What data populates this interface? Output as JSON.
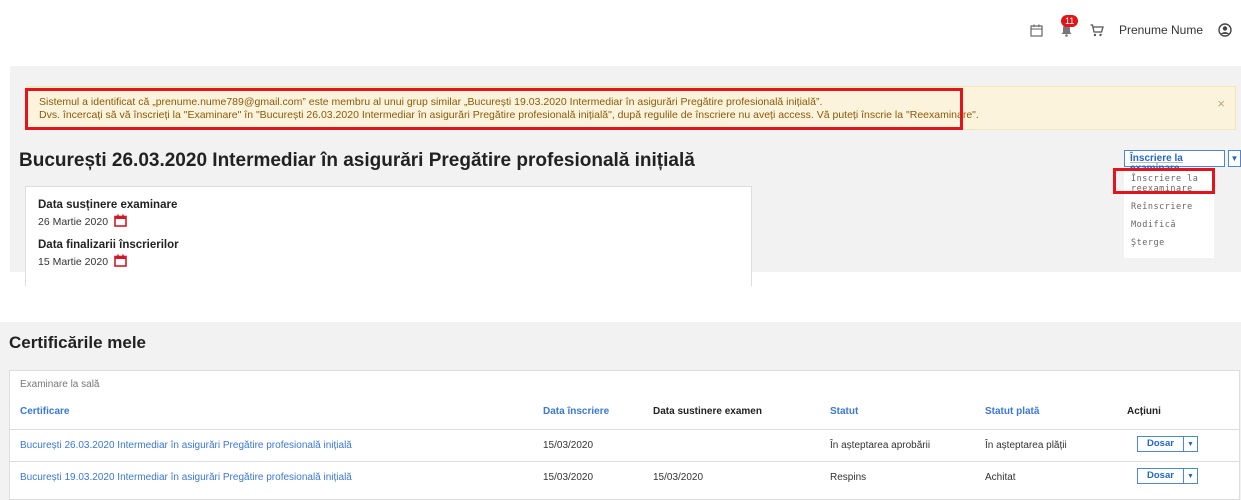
{
  "topbar": {
    "notifications_count": "11",
    "user_name": "Prenume Nume",
    "icons": [
      "calendar-icon",
      "bell-icon",
      "cart-icon",
      "user-circle-icon"
    ]
  },
  "alert": {
    "line1": "Sistemul a identificat că „prenume.nume789@gmail.com” este membru al unui grup similar „București 19.03.2020 Intermediar în asigurări Pregătire profesională inițială”.",
    "line2": "Dvs. încercați să vă înscrieți la \"Examinare\" în \"București 26.03.2020 Intermediar în asigurări Pregătire profesională inițială\", după regulile de înscriere nu aveți access. Vă puteți înscrie la \"Reexaminare\".",
    "close": "×"
  },
  "exam": {
    "title": "București 26.03.2020 Intermediar în asigurări Pregătire profesională inițială",
    "exam_date_label": "Data susținere examinare",
    "exam_date_value": "26 Martie 2020",
    "deadline_label": "Data finalizarii înscrierilor",
    "deadline_value": "15 Martie 2020"
  },
  "enroll_menu": {
    "button_label": "Înscriere la examinare",
    "items": [
      "Înscriere la reexaminare",
      "Reînscriere",
      "Modifică",
      "Șterge"
    ]
  },
  "certificates": {
    "title": "Certificările mele",
    "caption": "Examinare la sală",
    "columns": [
      "Certificare",
      "Data înscriere",
      "Data sustinere examen",
      "Statut",
      "Statut plată",
      "Acțiuni"
    ],
    "rows": [
      {
        "certificare": "București 26.03.2020 Intermediar în asigurări Pregătire profesională inițială",
        "data_inscriere": "15/03/2020",
        "data_examen": "",
        "statut": "În așteptarea aprobării",
        "statut_plata": "În așteptarea plății",
        "actiune": "Dosar"
      },
      {
        "certificare": "București 19.03.2020 Intermediar în asigurări Pregătire profesională inițială",
        "data_inscriere": "15/03/2020",
        "data_examen": "15/03/2020",
        "statut": "Respins",
        "statut_plata": "Achitat",
        "actiune": "Dosar"
      }
    ]
  }
}
